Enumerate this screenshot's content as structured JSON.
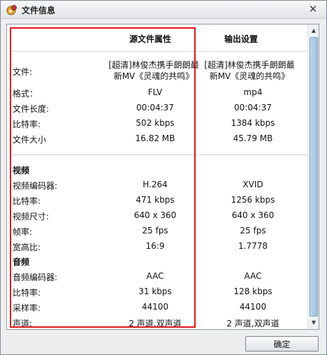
{
  "window": {
    "title": "文件信息"
  },
  "columns": {
    "source": "源文件属性",
    "output": "输出设置"
  },
  "file_row": {
    "label": "文件:",
    "source_lines": [
      "[超清]林俊杰携手朗朗最",
      "新MV《灵魂的共鸣》"
    ],
    "output_lines": [
      "[超清]林俊杰携手朗朗最",
      "新MV《灵魂的共鸣》"
    ]
  },
  "general_rows": [
    {
      "label": "格式：",
      "source": "FLV",
      "output": "mp4"
    },
    {
      "label": "文件长度:",
      "source": "00:04:37",
      "output": "00:04:37"
    },
    {
      "label": "比特率:",
      "source": "502 kbps",
      "output": "1384 kbps"
    },
    {
      "label": "文件大小",
      "source": "16.82 MB",
      "output": "45.79 MB"
    }
  ],
  "video": {
    "title": "视频",
    "rows": [
      {
        "label": "视频编码器:",
        "source": "H.264",
        "output": "XVID"
      },
      {
        "label": "比特率:",
        "source": "471 kbps",
        "output": "1256 kbps"
      },
      {
        "label": "视频尺寸:",
        "source": "640 x 360",
        "output": "640 x 360"
      },
      {
        "label": "帧率:",
        "source": "25 fps",
        "output": "25 fps"
      },
      {
        "label": "宽高比:",
        "source": "16:9",
        "output": "1.7778"
      }
    ]
  },
  "audio": {
    "title": "音频",
    "rows": [
      {
        "label": "音频编码器:",
        "source": "AAC",
        "output": "AAC"
      },
      {
        "label": "比特率:",
        "source": "31 kbps",
        "output": "128 kbps"
      },
      {
        "label": "采样率:",
        "source": "44100",
        "output": "44100"
      },
      {
        "label": "声道:",
        "source": "2 声道,双声道",
        "output": "2 声道,双声道"
      }
    ]
  },
  "buttons": {
    "ok": "确定"
  },
  "icons": {
    "app": "app-logo-icon",
    "close": "close-icon",
    "scroll_up": "scroll-up-arrow-icon",
    "scroll_down": "scroll-down-arrow-icon"
  },
  "colors": {
    "highlight": "#e0161a",
    "scroll_thumb": "#a9c8e2"
  }
}
